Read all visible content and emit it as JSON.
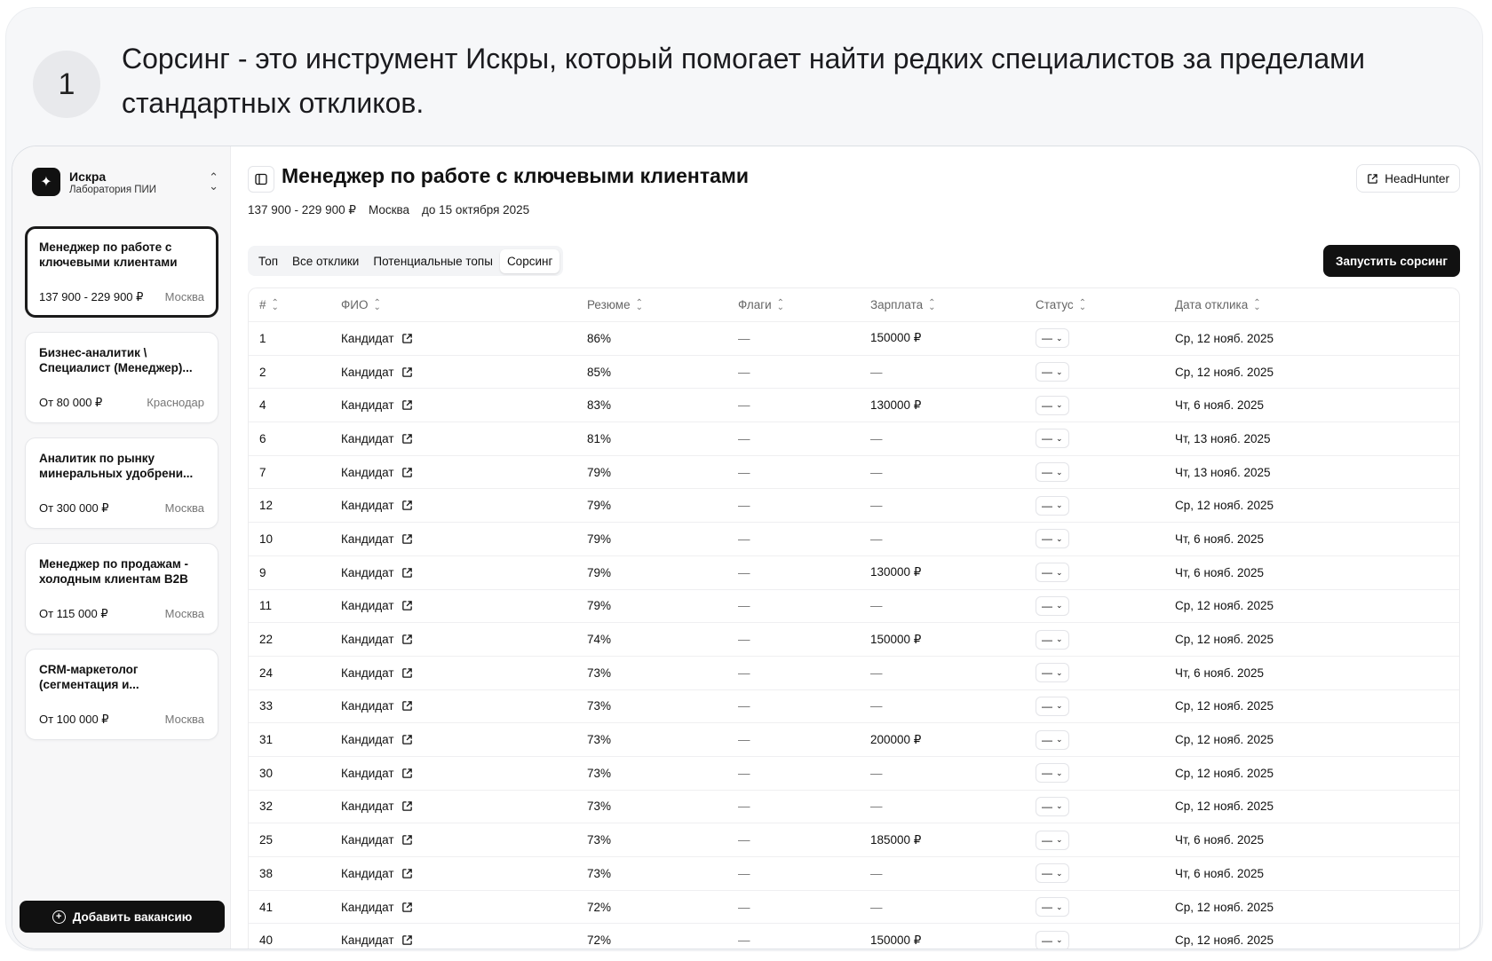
{
  "step": {
    "number": "1",
    "text": "Сорсинг - это инструмент Искры, который помогает найти редких специалистов за пределами стандартных откликов."
  },
  "sidebar": {
    "brand_name": "Искра",
    "brand_sub": "Лаборатория ПИИ",
    "vacancies": [
      {
        "title": "Менеджер по работе с ключевыми клиентами",
        "salary": "137 900 - 229 900 ₽",
        "city": "Москва"
      },
      {
        "title": "Бизнес-аналитик \\ Специалист (Менеджер)...",
        "salary": "От 80 000 ₽",
        "city": "Краснодар"
      },
      {
        "title": "Аналитик по рынку минеральных удобрени...",
        "salary": "От 300 000 ₽",
        "city": "Москва"
      },
      {
        "title": "Менеджер по продажам - холодным клиентам B2B",
        "salary": "От 115 000 ₽",
        "city": "Москва"
      },
      {
        "title": "CRM-маркетолог (сегментация и...",
        "salary": "От 100 000 ₽",
        "city": "Москва"
      }
    ],
    "add_button": "Добавить вакансию"
  },
  "header": {
    "title": "Менеджер по работе с ключевыми клиентами",
    "hh_button": "HeadHunter",
    "salary": "137 900 - 229 900 ₽",
    "city": "Москва",
    "deadline": "до 15 октября 2025"
  },
  "tabs": [
    "Топ",
    "Все отклики",
    "Потенциальные топы",
    "Сорсинг"
  ],
  "run_button": "Запустить сорсинг",
  "table": {
    "columns": [
      "#",
      "ФИО",
      "Резюме",
      "Флаги",
      "Зарплата",
      "Статус",
      "Дата отклика"
    ],
    "status_value": "—",
    "rows": [
      {
        "num": "1",
        "name": "Кандидат",
        "resume": "86%",
        "flags": "—",
        "salary": "150000 ₽",
        "date": "Ср, 12 нояб. 2025"
      },
      {
        "num": "2",
        "name": "Кандидат",
        "resume": "85%",
        "flags": "—",
        "salary": "—",
        "date": "Ср, 12 нояб. 2025"
      },
      {
        "num": "4",
        "name": "Кандидат",
        "resume": "83%",
        "flags": "—",
        "salary": "130000 ₽",
        "date": "Чт, 6 нояб. 2025"
      },
      {
        "num": "6",
        "name": "Кандидат",
        "resume": "81%",
        "flags": "—",
        "salary": "—",
        "date": "Чт, 13 нояб. 2025"
      },
      {
        "num": "7",
        "name": "Кандидат",
        "resume": "79%",
        "flags": "—",
        "salary": "—",
        "date": "Чт, 13 нояб. 2025"
      },
      {
        "num": "12",
        "name": "Кандидат",
        "resume": "79%",
        "flags": "—",
        "salary": "—",
        "date": "Ср, 12 нояб. 2025"
      },
      {
        "num": "10",
        "name": "Кандидат",
        "resume": "79%",
        "flags": "—",
        "salary": "—",
        "date": "Чт, 6 нояб. 2025"
      },
      {
        "num": "9",
        "name": "Кандидат",
        "resume": "79%",
        "flags": "—",
        "salary": "130000 ₽",
        "date": "Чт, 6 нояб. 2025"
      },
      {
        "num": "11",
        "name": "Кандидат",
        "resume": "79%",
        "flags": "—",
        "salary": "—",
        "date": "Ср, 12 нояб. 2025"
      },
      {
        "num": "22",
        "name": "Кандидат",
        "resume": "74%",
        "flags": "—",
        "salary": "150000 ₽",
        "date": "Ср, 12 нояб. 2025"
      },
      {
        "num": "24",
        "name": "Кандидат",
        "resume": "73%",
        "flags": "—",
        "salary": "—",
        "date": "Чт, 6 нояб. 2025"
      },
      {
        "num": "33",
        "name": "Кандидат",
        "resume": "73%",
        "flags": "—",
        "salary": "—",
        "date": "Ср, 12 нояб. 2025"
      },
      {
        "num": "31",
        "name": "Кандидат",
        "resume": "73%",
        "flags": "—",
        "salary": "200000 ₽",
        "date": "Ср, 12 нояб. 2025"
      },
      {
        "num": "30",
        "name": "Кандидат",
        "resume": "73%",
        "flags": "—",
        "salary": "—",
        "date": "Ср, 12 нояб. 2025"
      },
      {
        "num": "32",
        "name": "Кандидат",
        "resume": "73%",
        "flags": "—",
        "salary": "—",
        "date": "Ср, 12 нояб. 2025"
      },
      {
        "num": "25",
        "name": "Кандидат",
        "resume": "73%",
        "flags": "—",
        "salary": "185000 ₽",
        "date": "Чт, 6 нояб. 2025"
      },
      {
        "num": "38",
        "name": "Кандидат",
        "resume": "73%",
        "flags": "—",
        "salary": "—",
        "date": "Чт, 6 нояб. 2025"
      },
      {
        "num": "41",
        "name": "Кандидат",
        "resume": "72%",
        "flags": "—",
        "salary": "—",
        "date": "Ср, 12 нояб. 2025"
      },
      {
        "num": "40",
        "name": "Кандидат",
        "resume": "72%",
        "flags": "—",
        "salary": "150000 ₽",
        "date": "Ср, 12 нояб. 2025"
      }
    ]
  }
}
